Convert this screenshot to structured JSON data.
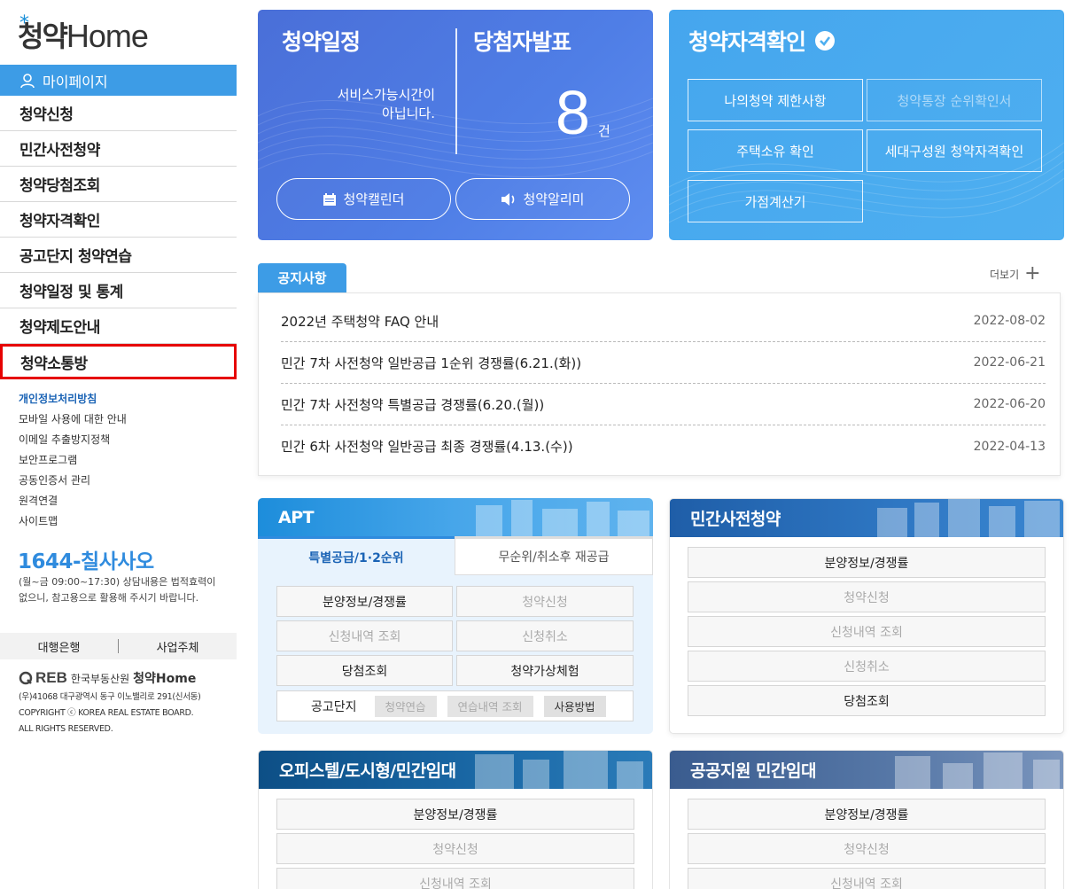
{
  "sidebar": {
    "logo_ko": "청약",
    "logo_en": "Home",
    "mypage": "마이페이지",
    "nav": [
      "청약신청",
      "민간사전청약",
      "청약당첨조회",
      "청약자격확인",
      "공고단지 청약연습",
      "청약일정 및 통계",
      "청약제도안내",
      "청약소통방"
    ],
    "links": [
      "개인정보처리방침",
      "모바일 사용에 대한 안내",
      "이메일 추출방지정책",
      "보안프로그램",
      "공동인증서 관리",
      "원격연결",
      "사이트맵"
    ],
    "phone": "1644-칠사사오",
    "phone_note": "(월~금 09:00~17:30) 상담내용은 법적효력이 없으니, 참고용으로 활용해 주시기 바랍니다.",
    "bank": "대행은행",
    "business": "사업주체",
    "footer_reb": "REB",
    "footer_org": "한국부동산원",
    "footer_home": "청약Home",
    "footer_address": "(우)41068 대구광역시 동구 이노밸리로 291(신서동)",
    "footer_copyright": "COPYRIGHT ⓒ KOREA REAL ESTATE BOARD.",
    "footer_rights": "ALL RIGHTS RESERVED."
  },
  "schedule_card": {
    "title": "청약일정",
    "winner_title": "당첨자발표",
    "service_line1": "서비스가능시간이",
    "service_line2": "아닙니다.",
    "count": "8",
    "unit": "건",
    "calendar_btn": "청약캘린더",
    "alarm_btn": "청약알리미"
  },
  "qual_card": {
    "title": "청약자격확인",
    "buttons": [
      "나의청약 제한사항",
      "청약통장 순위확인서",
      "주택소유 확인",
      "세대구성원 청약자격확인",
      "가점계산기"
    ]
  },
  "notice": {
    "tab": "공지사항",
    "more": "더보기",
    "items": [
      {
        "title": "2022년 주택청약 FAQ 안내",
        "date": "2022-08-02"
      },
      {
        "title": "민간 7차 사전청약 일반공급 1순위 경쟁률(6.21.(화))",
        "date": "2022-06-21"
      },
      {
        "title": "민간 7차 사전청약 특별공급 경쟁률(6.20.(월))",
        "date": "2022-06-20"
      },
      {
        "title": "민간 6차 사전청약 일반공급 최종 경쟁률(4.13.(수))",
        "date": "2022-04-13"
      }
    ]
  },
  "apt": {
    "title": "APT",
    "tab_active": "특별공급/1·2순위",
    "tab_inactive": "무순위/취소후 재공급",
    "buttons": [
      "분양정보/경쟁률",
      "청약신청",
      "신청내역 조회",
      "신청취소",
      "당첨조회",
      "청약가상체험"
    ],
    "practice_label": "공고단지",
    "chips": [
      "청약연습",
      "연습내역 조회",
      "사용방법"
    ]
  },
  "presale": {
    "title": "민간사전청약",
    "buttons": [
      "분양정보/경쟁률",
      "청약신청",
      "신청내역 조회",
      "신청취소",
      "당첨조회"
    ]
  },
  "officetel": {
    "title": "오피스텔/도시형/민간임대",
    "buttons": [
      "분양정보/경쟁률",
      "청약신청",
      "신청내역 조회"
    ]
  },
  "public_rental": {
    "title": "공공지원 민간임대",
    "buttons": [
      "분양정보/경쟁률",
      "청약신청",
      "신청내역 조회"
    ]
  },
  "colors": {
    "accent": "#3d9ce6",
    "schedule_bg": "#4f7ee6",
    "qual_bg": "#4eaff0",
    "highlight_border": "#e60000",
    "phone": "#2f8bde"
  }
}
